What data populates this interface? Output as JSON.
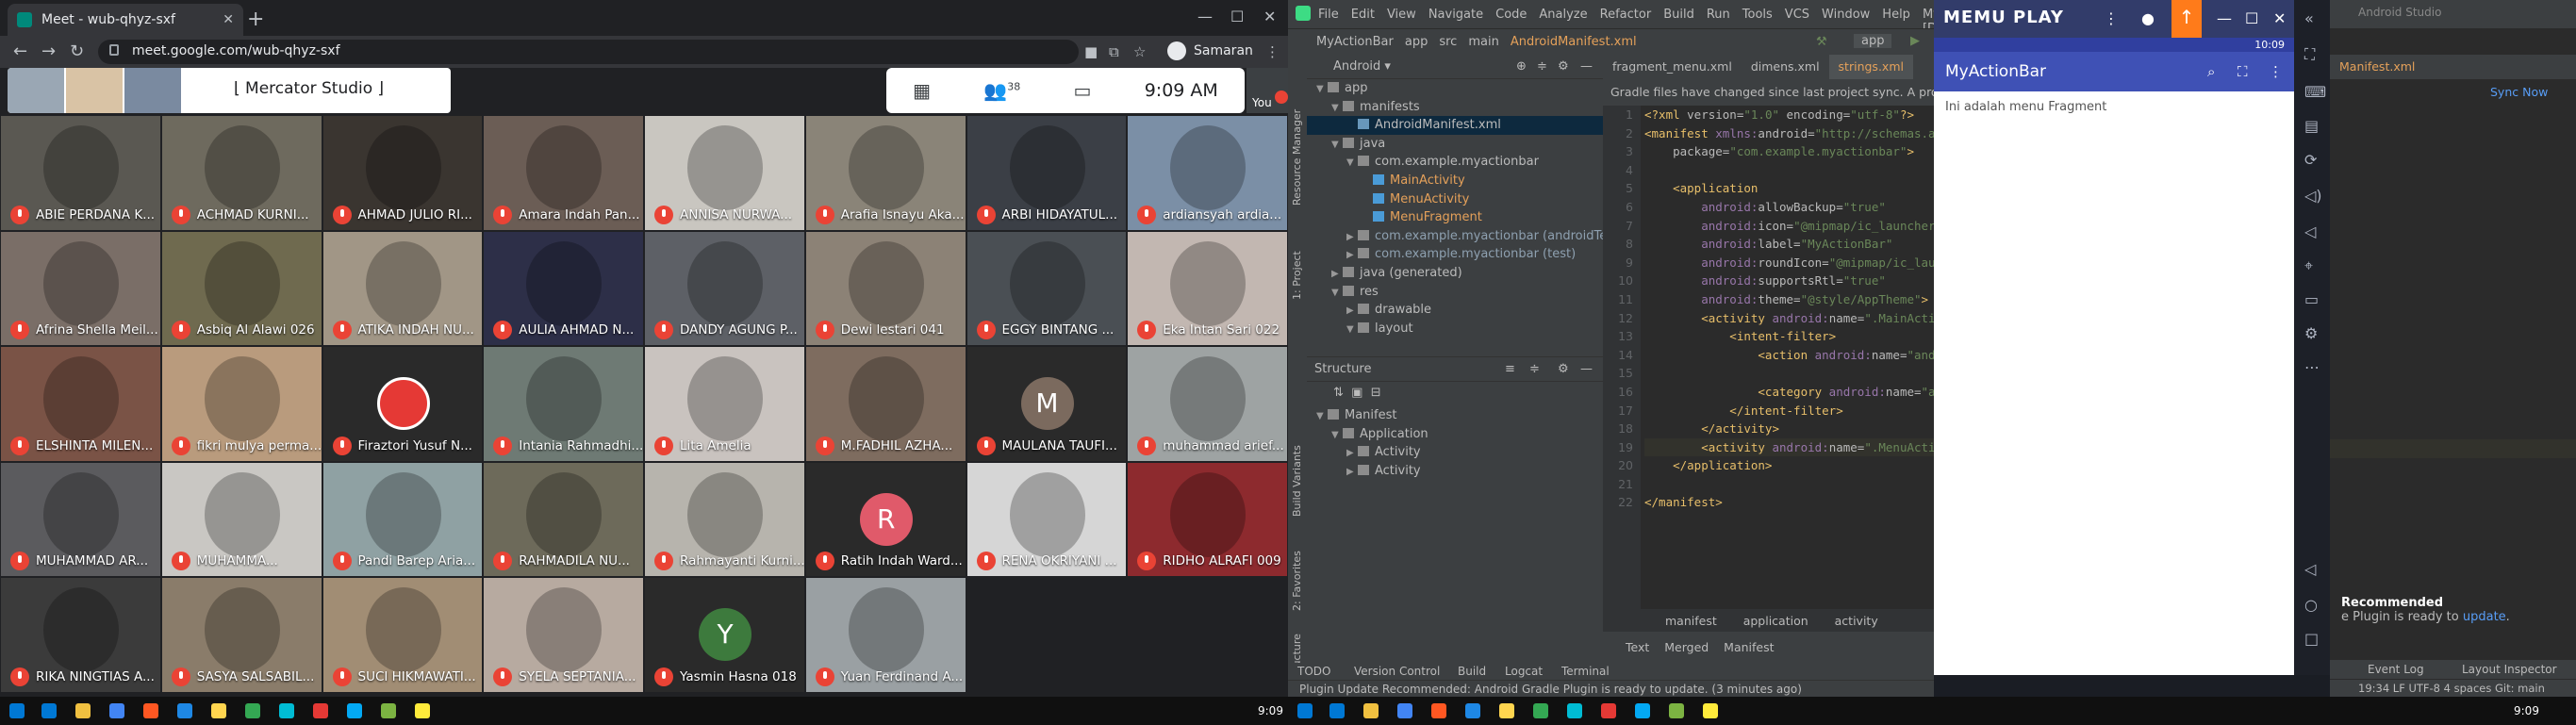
{
  "chrome": {
    "tab_title": "Meet - wub-qhyz-sxf",
    "new_tab": "+",
    "url": "meet.google.com/wub-qhyz-sxf",
    "profile_name": "Samaran"
  },
  "meet": {
    "presenter_label": "⌊ Mercator Studio ⌋",
    "participants_count": "38",
    "time": "9:09 AM",
    "you_label": "You",
    "tiles": [
      {
        "name": "ABIE PERDANA K...",
        "bg": "#5a5852"
      },
      {
        "name": "ACHMAD KURNI...",
        "bg": "#6e6a5e"
      },
      {
        "name": "AHMAD JULIO RI...",
        "bg": "#3a3530"
      },
      {
        "name": "Amara Indah Pan...",
        "bg": "#6b5d55"
      },
      {
        "name": "ANNISA NURWA...",
        "bg": "#c9c6c0"
      },
      {
        "name": "Arafia Isnayu Aka...",
        "bg": "#8a8478"
      },
      {
        "name": "ARBI HIDAYATUL...",
        "bg": "#3b3f46"
      },
      {
        "name": "ardiansyah ardia...",
        "bg": "#7b8fa6"
      },
      {
        "name": "Afrina Shella Meil...",
        "bg": "#7a6e67"
      },
      {
        "name": "Asbiq Al Alawi 026",
        "bg": "#6f6a4f"
      },
      {
        "name": "ATIKA INDAH NU...",
        "bg": "#a19686"
      },
      {
        "name": "AULIA AHMAD N...",
        "bg": "#2d2f48"
      },
      {
        "name": "DANDY AGUNG P...",
        "bg": "#5d6066"
      },
      {
        "name": "Dewi lestari 041",
        "bg": "#8c8276"
      },
      {
        "name": "EGGY BINTANG ...",
        "bg": "#4a4f54"
      },
      {
        "name": "Eka Intan Sari 022",
        "bg": "#c2b7b1"
      },
      {
        "name": "ELSHINTA MILEN...",
        "bg": "#7a5346"
      },
      {
        "name": "fikri mulya perma...",
        "bg": "#b99b7d"
      },
      {
        "name": "Firaztori Yusuf N...",
        "bg": "#2a2a2a"
      },
      {
        "name": "Intania Rahmadhi...",
        "bg": "#6e7a74"
      },
      {
        "name": "Lita Amelia",
        "bg": "#c9c3bf"
      },
      {
        "name": "M.FADHIL AZHA...",
        "bg": "#7e6c5f"
      },
      {
        "name": "MAULANA TAUFI...",
        "bg": "#2a2a2a"
      },
      {
        "name": "muhammad arief...",
        "bg": "#9ea3a3"
      },
      {
        "name": "MUHAMMAD AR...",
        "bg": "#5b5b5e"
      },
      {
        "name": "MUHAMMA...",
        "bg": "#c9c7c3"
      },
      {
        "name": "Pandi Barep Aria...",
        "bg": "#8fa1a3"
      },
      {
        "name": "RAHMADILA NU...",
        "bg": "#6d6a5a"
      },
      {
        "name": "Rahmayanti Kurni...",
        "bg": "#b7b4ad"
      },
      {
        "name": "Ratih Indah Ward...",
        "bg": "#2a2a2a"
      },
      {
        "name": "RENA OKRIYANI ...",
        "bg": "#d6d6d6"
      },
      {
        "name": "RIDHO ALRAFI 009",
        "bg": "#8d2a2e"
      },
      {
        "name": "RIKA NINGTIAS A...",
        "bg": "#3b3b3b"
      },
      {
        "name": "SASYA SALSABIL...",
        "bg": "#8a7c6a"
      },
      {
        "name": "SUCI HIKMAWATI...",
        "bg": "#a18d74"
      },
      {
        "name": "SYELA SEPTANIA...",
        "bg": "#b7aaa0"
      },
      {
        "name": "Yasmin Hasna 018",
        "bg": "#2a2a2a"
      },
      {
        "name": "Yuan Ferdinand A...",
        "bg": "#9aa0a3"
      }
    ],
    "letters": {
      "M": "M",
      "R": "R",
      "Y": "Y"
    }
  },
  "studio": {
    "menu": [
      "File",
      "Edit",
      "View",
      "Navigate",
      "Code",
      "Analyze",
      "Refactor",
      "Build",
      "Run",
      "Tools",
      "VCS",
      "Window",
      "Help",
      "MyActionBar [D:\\"
    ],
    "breadcrumb": [
      "MyActionBar",
      "app",
      "src",
      "main",
      "AndroidManifest.xml"
    ],
    "run_config": "app",
    "project_view": "Android",
    "tree": [
      {
        "label": "app",
        "indent": 0,
        "arrow": "▼",
        "color": "#bbbbbb",
        "icon": "#8c8c8c"
      },
      {
        "label": "manifests",
        "indent": 1,
        "arrow": "▼",
        "color": "#bbbbbb",
        "icon": "#8c8c8c"
      },
      {
        "label": "AndroidManifest.xml",
        "indent": 2,
        "arrow": "",
        "color": "#bbbbbb",
        "icon": "#6897bb",
        "selected": true
      },
      {
        "label": "java",
        "indent": 1,
        "arrow": "▼",
        "color": "#bbbbbb",
        "icon": "#8c8c8c"
      },
      {
        "label": "com.example.myactionbar",
        "indent": 2,
        "arrow": "▼",
        "color": "#bbbbbb",
        "icon": "#8c8c8c"
      },
      {
        "label": "MainActivity",
        "indent": 3,
        "arrow": "",
        "color": "#e5a15a",
        "icon": "#4a9bd7"
      },
      {
        "label": "MenuActivity",
        "indent": 3,
        "arrow": "",
        "color": "#e5a15a",
        "icon": "#4a9bd7"
      },
      {
        "label": "MenuFragment",
        "indent": 3,
        "arrow": "",
        "color": "#e5a15a",
        "icon": "#4a9bd7"
      },
      {
        "label": "com.example.myactionbar (androidTest)",
        "indent": 2,
        "arrow": "▶",
        "color": "#bbbbbb",
        "icon": "#8c8c8c",
        "muted": true
      },
      {
        "label": "com.example.myactionbar (test)",
        "indent": 2,
        "arrow": "▶",
        "color": "#bbbbbb",
        "icon": "#8c8c8c",
        "muted": true
      },
      {
        "label": "java (generated)",
        "indent": 1,
        "arrow": "▶",
        "color": "#bbbbbb",
        "icon": "#8c8c8c"
      },
      {
        "label": "res",
        "indent": 1,
        "arrow": "▼",
        "color": "#bbbbbb",
        "icon": "#8c8c8c"
      },
      {
        "label": "drawable",
        "indent": 2,
        "arrow": "▶",
        "color": "#bbbbbb",
        "icon": "#8c8c8c"
      },
      {
        "label": "layout",
        "indent": 2,
        "arrow": "▼",
        "color": "#bbbbbb",
        "icon": "#8c8c8c"
      }
    ],
    "structure_title": "Structure",
    "structure_tree": [
      {
        "label": "Manifest",
        "indent": 0,
        "arrow": "▼"
      },
      {
        "label": "Application",
        "indent": 1,
        "arrow": "▼"
      },
      {
        "label": "Activity",
        "indent": 2,
        "arrow": "▶"
      },
      {
        "label": "Activity",
        "indent": 2,
        "arrow": "▶"
      }
    ],
    "editor_tabs": [
      "fragment_menu.xml",
      "dimens.xml",
      "strings.xml"
    ],
    "notice": "Gradle files have changed since last project sync. A project sync may be necessary",
    "line_numbers": [
      "1",
      "2",
      "3",
      "4",
      "5",
      "6",
      "7",
      "8",
      "9",
      "10",
      "11",
      "12",
      "13",
      "14",
      "15",
      "16",
      "17",
      "18",
      "19",
      "20",
      "21",
      "22"
    ],
    "code": [
      [
        {
          "c": "tg",
          "t": "<?xml "
        },
        {
          "c": "at",
          "t": "version="
        },
        {
          "c": "st",
          "t": "\"1.0\" "
        },
        {
          "c": "at",
          "t": "encoding="
        },
        {
          "c": "st",
          "t": "\"utf-8\""
        },
        {
          "c": "tg",
          "t": "?>"
        }
      ],
      [
        {
          "c": "tg",
          "t": "<manifest "
        },
        {
          "c": "ns",
          "t": "xmlns:"
        },
        {
          "c": "at",
          "t": "android="
        },
        {
          "c": "st",
          "t": "\"http://schemas.andr"
        }
      ],
      [
        {
          "c": "at",
          "t": "    package="
        },
        {
          "c": "st",
          "t": "\"com.example.myactionbar\""
        },
        {
          "c": "tg",
          "t": ">"
        }
      ],
      [],
      [
        {
          "c": "tg",
          "t": "    <application"
        }
      ],
      [
        {
          "c": "ns",
          "t": "        android:"
        },
        {
          "c": "at",
          "t": "allowBackup="
        },
        {
          "c": "st",
          "t": "\"true\""
        }
      ],
      [
        {
          "c": "ns",
          "t": "        android:"
        },
        {
          "c": "at",
          "t": "icon="
        },
        {
          "c": "st",
          "t": "\"@mipmap/ic_launcher\""
        }
      ],
      [
        {
          "c": "ns",
          "t": "        android:"
        },
        {
          "c": "at",
          "t": "label="
        },
        {
          "c": "st",
          "t": "\"MyActionBar\""
        }
      ],
      [
        {
          "c": "ns",
          "t": "        android:"
        },
        {
          "c": "at",
          "t": "roundIcon="
        },
        {
          "c": "st",
          "t": "\"@mipmap/ic_launch"
        }
      ],
      [
        {
          "c": "ns",
          "t": "        android:"
        },
        {
          "c": "at",
          "t": "supportsRtl="
        },
        {
          "c": "st",
          "t": "\"true\""
        }
      ],
      [
        {
          "c": "ns",
          "t": "        android:"
        },
        {
          "c": "at",
          "t": "theme="
        },
        {
          "c": "st",
          "t": "\"@style/AppTheme\""
        },
        {
          "c": "tg",
          "t": ">"
        }
      ],
      [
        {
          "c": "tg",
          "t": "        <activity "
        },
        {
          "c": "ns",
          "t": "android:"
        },
        {
          "c": "at",
          "t": "name="
        },
        {
          "c": "st",
          "t": "\".MainActivi"
        }
      ],
      [
        {
          "c": "tg",
          "t": "            <intent-filter>"
        }
      ],
      [
        {
          "c": "tg",
          "t": "                <action "
        },
        {
          "c": "ns",
          "t": "android:"
        },
        {
          "c": "at",
          "t": "name="
        },
        {
          "c": "st",
          "t": "\"andr"
        }
      ],
      [],
      [
        {
          "c": "tg",
          "t": "                <category "
        },
        {
          "c": "ns",
          "t": "android:"
        },
        {
          "c": "at",
          "t": "name="
        },
        {
          "c": "st",
          "t": "\"a"
        }
      ],
      [
        {
          "c": "tg",
          "t": "            </intent-filter>"
        }
      ],
      [
        {
          "c": "tg",
          "t": "        </activity>"
        }
      ],
      [
        {
          "c": "tg",
          "t": "        <activity "
        },
        {
          "c": "ns",
          "t": "android:"
        },
        {
          "c": "at",
          "t": "name="
        },
        {
          "c": "st",
          "t": "\".MenuActivi"
        }
      ],
      [
        {
          "c": "tg",
          "t": "    </application>"
        }
      ],
      [],
      [
        {
          "c": "tg",
          "t": "</manifest>"
        }
      ]
    ],
    "code_breadcrumb": "manifest application activity",
    "view_tabs": "Text Merged Manifest",
    "bottom_tools": [
      "TODO",
      "Version Control",
      "Build",
      "Logcat",
      "Terminal"
    ],
    "status": "Plugin Update Recommended: Android Gradle Plugin is ready to update. (3 minutes ago)",
    "side_tools": [
      "Resource Manager",
      "1: Project",
      "Build Variants",
      "2: Favorites",
      "Z: Structure"
    ]
  },
  "memu": {
    "logo": "MEMU PLAY",
    "status_time": "10:09",
    "app_title": "MyActionBar",
    "fragment_text": "Ini adalah menu Fragment"
  },
  "studio2": {
    "title": "Android Studio",
    "tab": "Manifest.xml",
    "sync": "Sync Now",
    "notif_title": "Recommended",
    "notif_body": "e Plugin is ready to ",
    "notif_link": "update",
    "event_log": "Event Log",
    "layout_inspector": "Layout Inspector",
    "status": "19:34  LF  UTF-8  4 spaces  Git: main"
  },
  "taskbar": {
    "left_time": "9:09",
    "right_time": "9:09",
    "icon_colors": [
      "#0078d4",
      "#f0c040",
      "#4285f4",
      "#ff5722",
      "#1e88e5",
      "#ffd54f",
      "#34a853",
      "#00bcd4",
      "#e53935",
      "#03a9f4",
      "#7cb342",
      "#ffeb3b"
    ]
  },
  "colors": {
    "accent": "#3f51b5",
    "mute": "#ea4335",
    "memu": "#323c6a"
  }
}
